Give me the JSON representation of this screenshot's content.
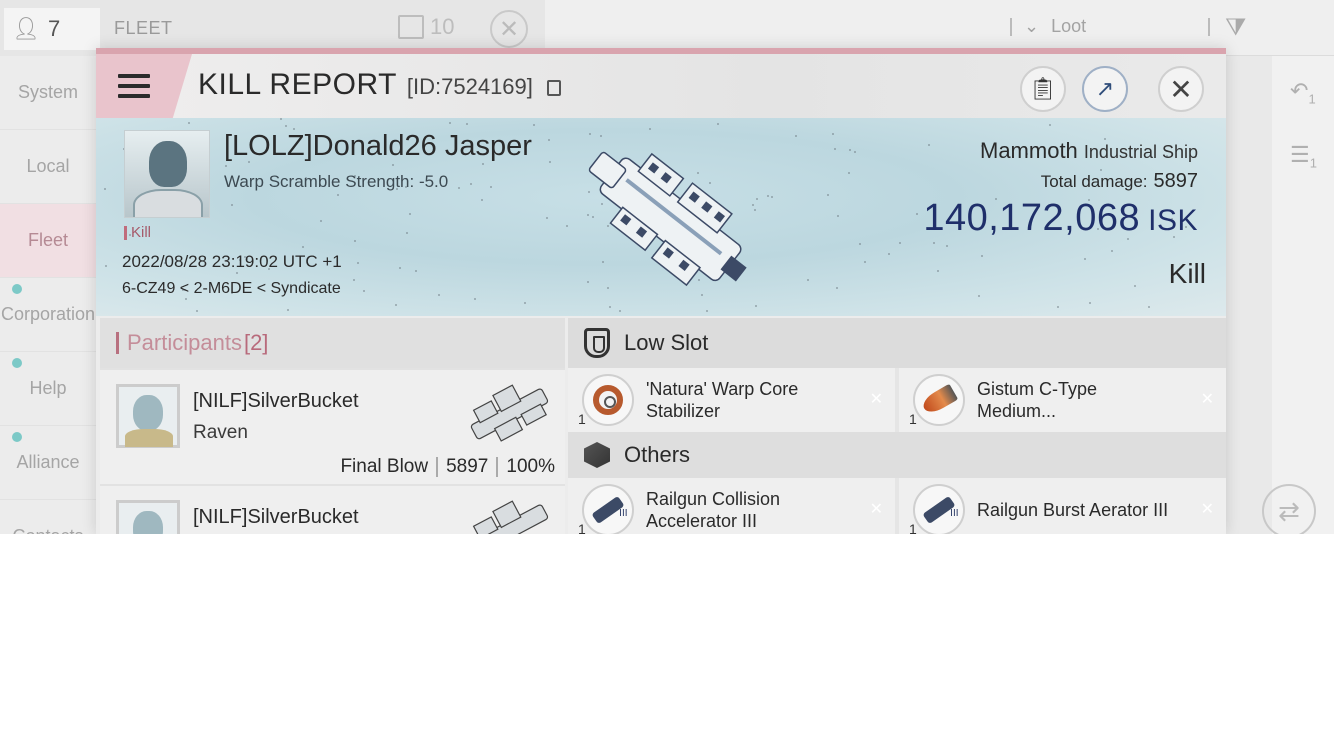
{
  "topbar": {
    "member_count": "7",
    "fleet_label": "FLEET",
    "fleet_count": "10",
    "loot_label": "Loot"
  },
  "sidebar": {
    "items": [
      {
        "label": "System"
      },
      {
        "label": "Local"
      },
      {
        "label": "Fleet"
      },
      {
        "label": "Corporation"
      },
      {
        "label": "Help"
      },
      {
        "label": "Alliance"
      },
      {
        "label": "Contacts"
      }
    ]
  },
  "right_strip": {
    "badge_a": "1",
    "badge_b": "1"
  },
  "dialog": {
    "title": "KILL REPORT",
    "id": "[ID:7524169]"
  },
  "victim": {
    "name": "[LOLZ]Donald26 Jasper",
    "scramble": "Warp Scramble Strength: -5.0",
    "tag": "Kill",
    "datetime": "2022/08/28 23:19:02 UTC +1",
    "location": "6-CZ49 < 2-M6DE < Syndicate",
    "ship_name": "Mammoth",
    "ship_class": "Industrial Ship",
    "damage_label": "Total damage:",
    "damage_value": "5897",
    "isk_value": "140,172,068",
    "isk_unit": "ISK",
    "result": "Kill"
  },
  "participants": {
    "label": "Participants",
    "count": "[2]",
    "rows": [
      {
        "name": "[NILF]SilverBucket",
        "ship": "Raven",
        "blow": "Final Blow",
        "damage": "5897",
        "percent": "100%"
      },
      {
        "name": "[NILF]SilverBucket"
      }
    ]
  },
  "items": {
    "low_slot_label": "Low Slot",
    "others_label": "Others",
    "low_slot": [
      {
        "name": "'Natura' Warp Core Stabilizer",
        "qty": "1",
        "icon": "warp-core-icon",
        "accent": "#b75a2e"
      },
      {
        "name": "Gistum C-Type Medium...",
        "qty": "1",
        "icon": "afterburner-icon",
        "accent": "#c14a1c"
      }
    ],
    "others": [
      {
        "name": "Railgun Collision Accelerator III",
        "qty": "1",
        "icon": "railgun-icon"
      },
      {
        "name": "Railgun Burst Aerator III",
        "qty": "1",
        "icon": "railgun-icon"
      }
    ]
  },
  "colors": {
    "accent_pink": "#d9a4ae",
    "isk_blue": "#1f2f6a",
    "hero_bg": "#c7dfe6"
  }
}
